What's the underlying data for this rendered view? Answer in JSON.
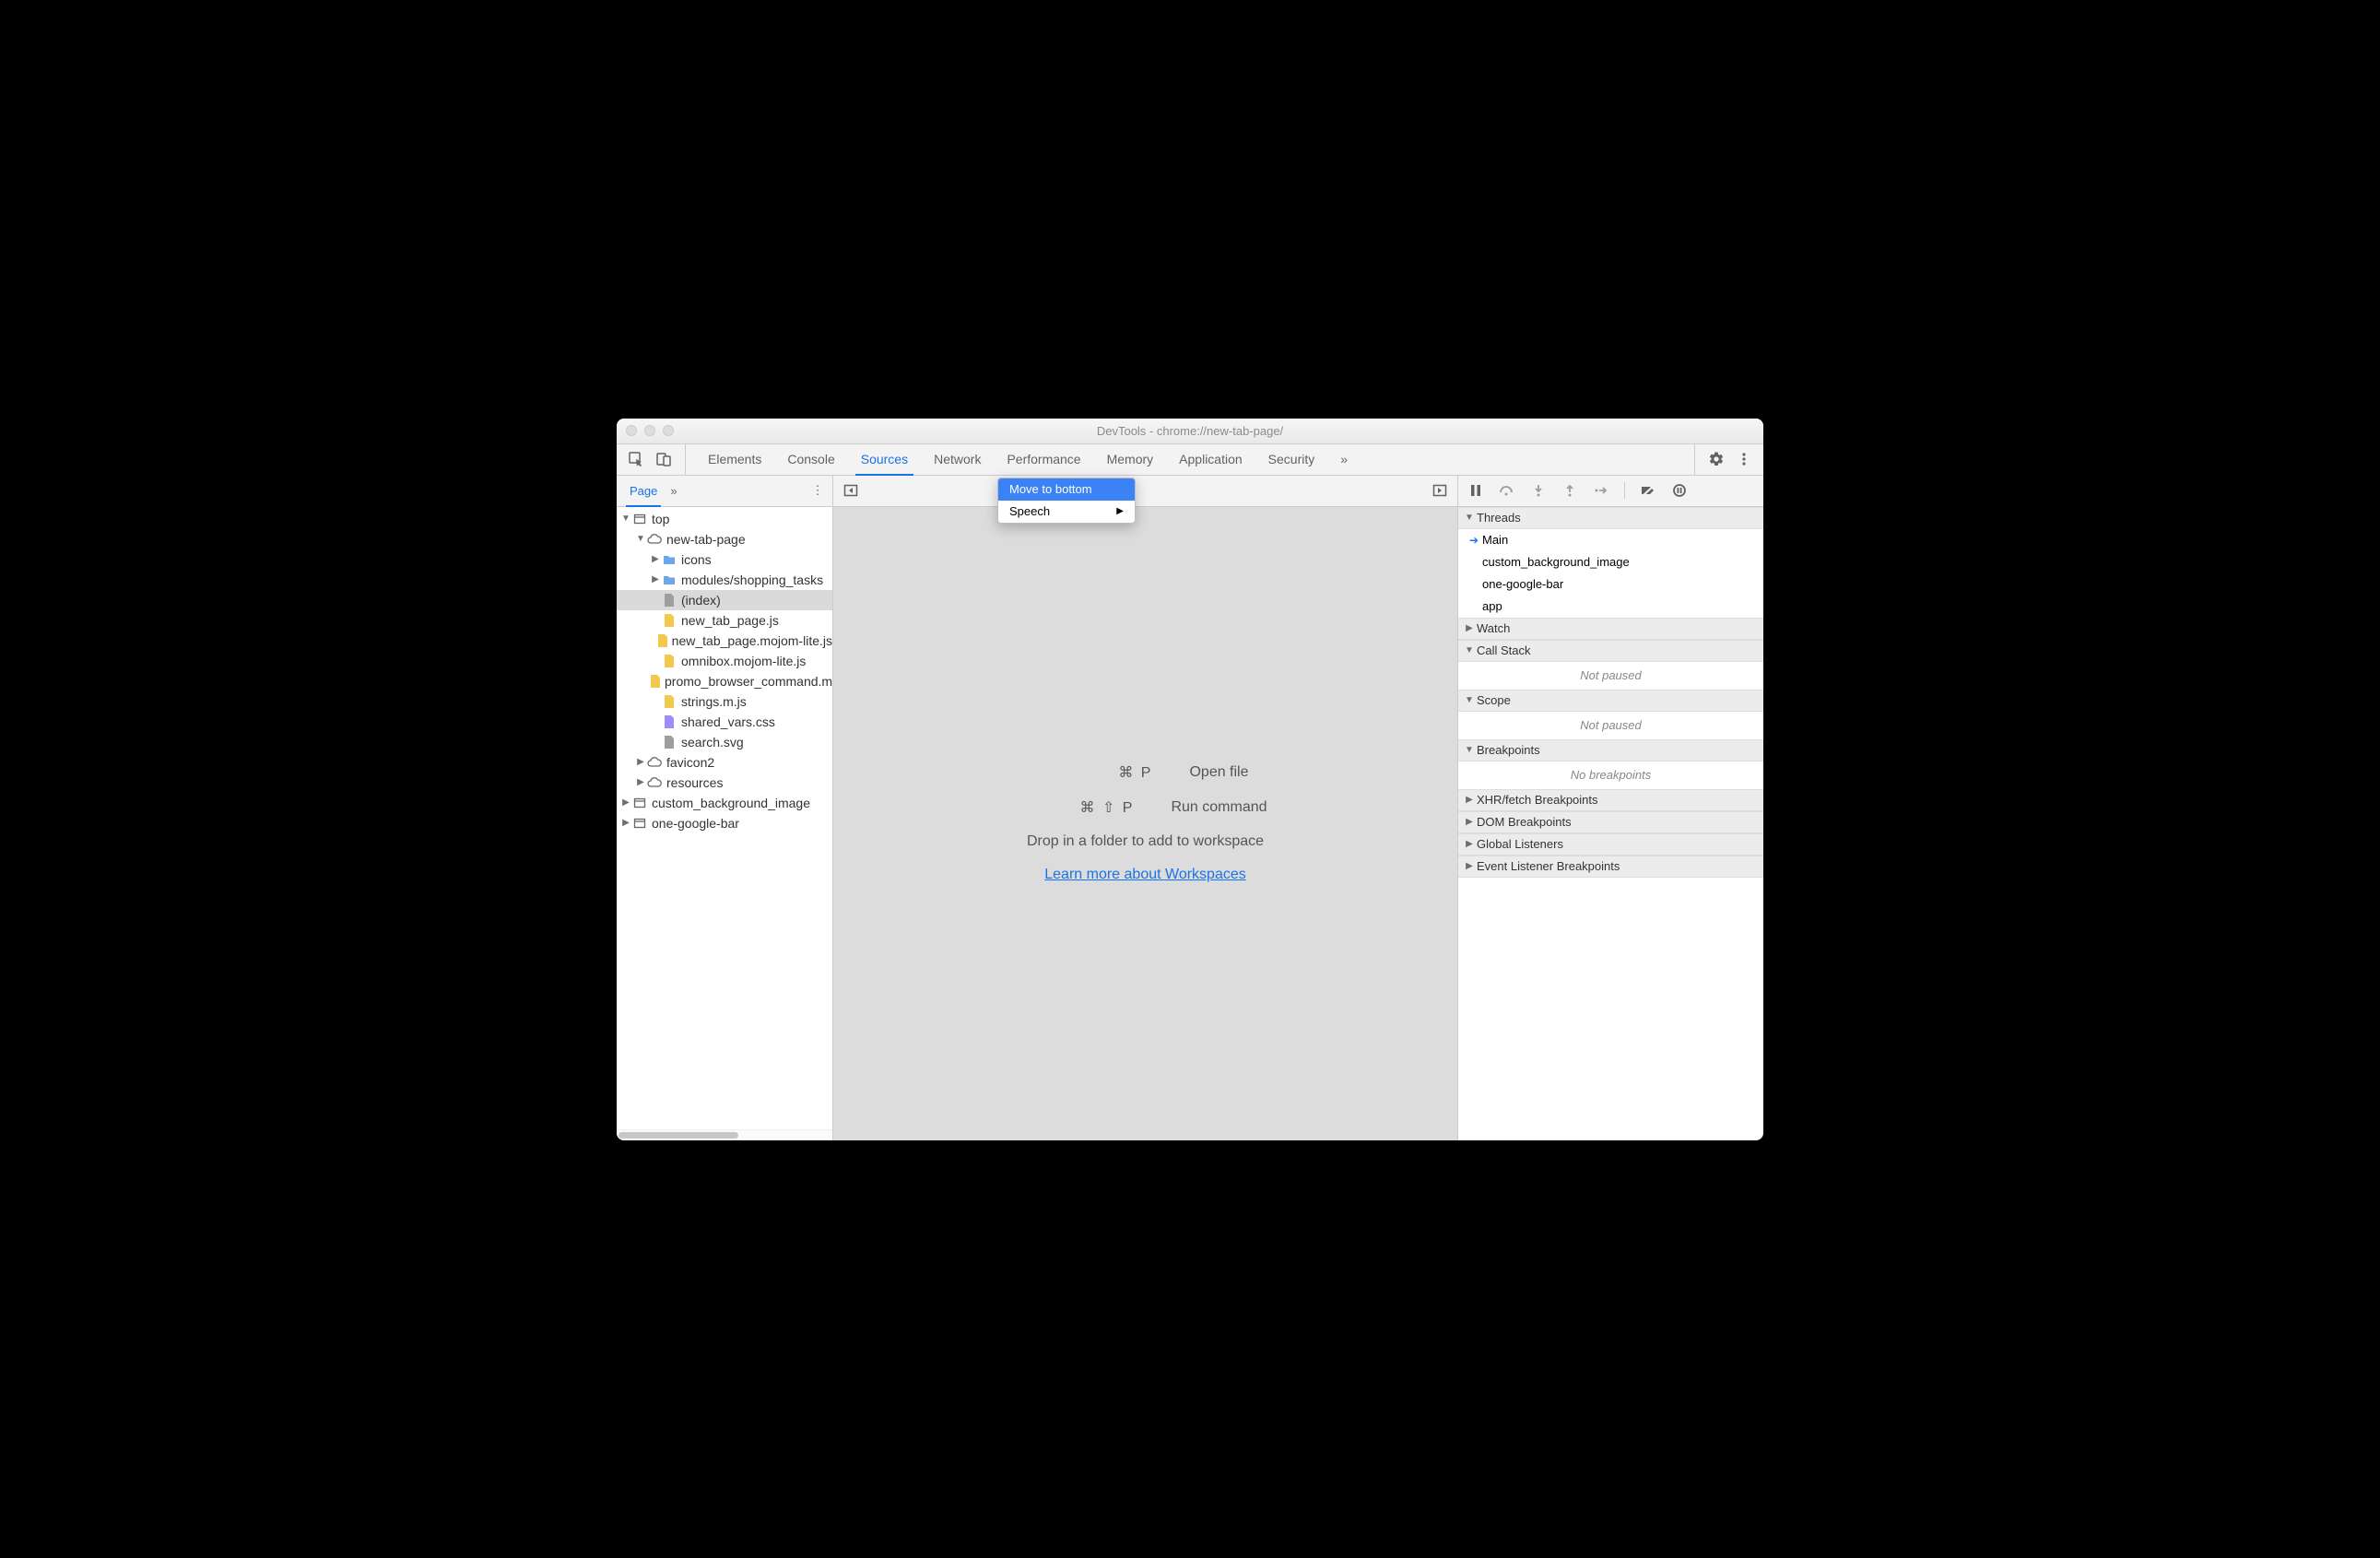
{
  "window_title": "DevTools - chrome://new-tab-page/",
  "toolbar_tabs": [
    "Elements",
    "Console",
    "Sources",
    "Network",
    "Performance",
    "Memory",
    "Application",
    "Security"
  ],
  "toolbar_active": "Sources",
  "toolbar_overflow": "»",
  "context_menu": {
    "items": [
      "Move to bottom",
      "Speech"
    ],
    "highlighted": 0,
    "submenu_glyph": "▶"
  },
  "left": {
    "subtab": "Page",
    "overflow": "»",
    "more_glyph": "⋮",
    "tree": [
      {
        "depth": 0,
        "twisty": "▼",
        "icon": "frame",
        "label": "top"
      },
      {
        "depth": 1,
        "twisty": "▼",
        "icon": "cloud",
        "label": "new-tab-page"
      },
      {
        "depth": 2,
        "twisty": "▶",
        "icon": "folder",
        "label": "icons"
      },
      {
        "depth": 2,
        "twisty": "▶",
        "icon": "folder",
        "label": "modules/shopping_tasks"
      },
      {
        "depth": 2,
        "twisty": "",
        "icon": "file-gray",
        "label": "(index)",
        "selected": true
      },
      {
        "depth": 2,
        "twisty": "",
        "icon": "file-js",
        "label": "new_tab_page.js"
      },
      {
        "depth": 2,
        "twisty": "",
        "icon": "file-js",
        "label": "new_tab_page.mojom-lite.js"
      },
      {
        "depth": 2,
        "twisty": "",
        "icon": "file-js",
        "label": "omnibox.mojom-lite.js"
      },
      {
        "depth": 2,
        "twisty": "",
        "icon": "file-js",
        "label": "promo_browser_command.mojom-lite.js"
      },
      {
        "depth": 2,
        "twisty": "",
        "icon": "file-js",
        "label": "strings.m.js"
      },
      {
        "depth": 2,
        "twisty": "",
        "icon": "file-css",
        "label": "shared_vars.css"
      },
      {
        "depth": 2,
        "twisty": "",
        "icon": "file-gray",
        "label": "search.svg"
      },
      {
        "depth": 1,
        "twisty": "▶",
        "icon": "cloud",
        "label": "favicon2"
      },
      {
        "depth": 1,
        "twisty": "▶",
        "icon": "cloud",
        "label": "resources"
      },
      {
        "depth": 0,
        "twisty": "▶",
        "icon": "frame",
        "label": "custom_background_image"
      },
      {
        "depth": 0,
        "twisty": "▶",
        "icon": "frame",
        "label": "one-google-bar"
      }
    ]
  },
  "center": {
    "open_file_keys": "⌘  P",
    "open_file_label": "Open file",
    "run_cmd_keys": "⌘  ⇧  P",
    "run_cmd_label": "Run command",
    "drop_hint": "Drop in a folder to add to workspace",
    "learn_link": "Learn more about Workspaces"
  },
  "right": {
    "sections": {
      "threads": {
        "label": "Threads",
        "open": true,
        "items": [
          "Main",
          "custom_background_image",
          "one-google-bar",
          "app"
        ],
        "active": 0
      },
      "watch": {
        "label": "Watch",
        "open": false
      },
      "callstack": {
        "label": "Call Stack",
        "open": true,
        "placeholder": "Not paused"
      },
      "scope": {
        "label": "Scope",
        "open": true,
        "placeholder": "Not paused"
      },
      "breakpoints": {
        "label": "Breakpoints",
        "open": true,
        "placeholder": "No breakpoints"
      },
      "xhr": {
        "label": "XHR/fetch Breakpoints",
        "open": false
      },
      "dom": {
        "label": "DOM Breakpoints",
        "open": false
      },
      "global": {
        "label": "Global Listeners",
        "open": false
      },
      "event": {
        "label": "Event Listener Breakpoints",
        "open": false
      }
    }
  }
}
